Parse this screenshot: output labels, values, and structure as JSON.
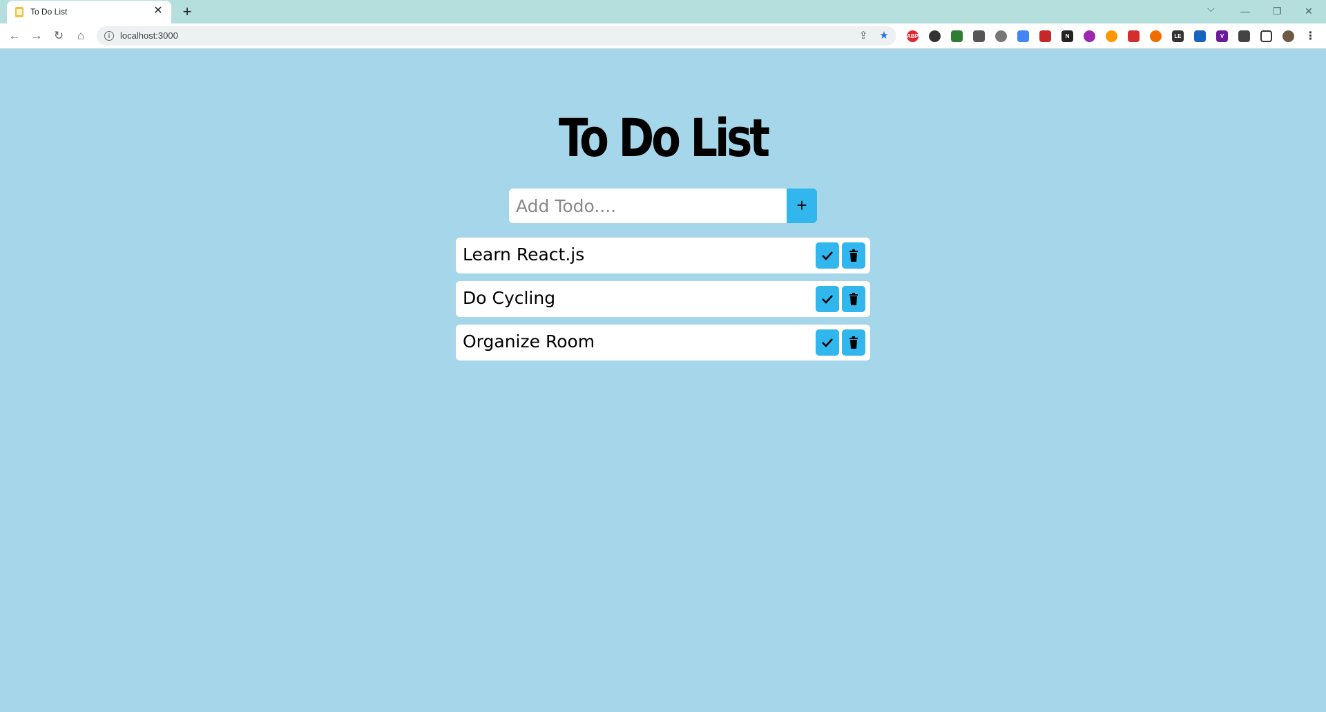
{
  "browser": {
    "tab_title": "To Do List",
    "url": "localhost:3000",
    "window_controls": [
      "minimize",
      "restore",
      "close"
    ],
    "extensions": [
      "ABP",
      "",
      "",
      "",
      "",
      "",
      "",
      "N",
      "",
      "",
      "",
      "",
      "",
      "LE",
      "",
      "V",
      "",
      "",
      ""
    ]
  },
  "app": {
    "title": "To Do List",
    "input": {
      "placeholder": "Add Todo....",
      "value": ""
    },
    "add_button_label": "+",
    "todos": [
      {
        "text": "Learn React.js"
      },
      {
        "text": "Do Cycling"
      },
      {
        "text": "Organize Room"
      }
    ]
  },
  "colors": {
    "page_background": "#a5d6ea",
    "accent": "#31b6ed",
    "tab_strip": "#b4dfdd"
  }
}
